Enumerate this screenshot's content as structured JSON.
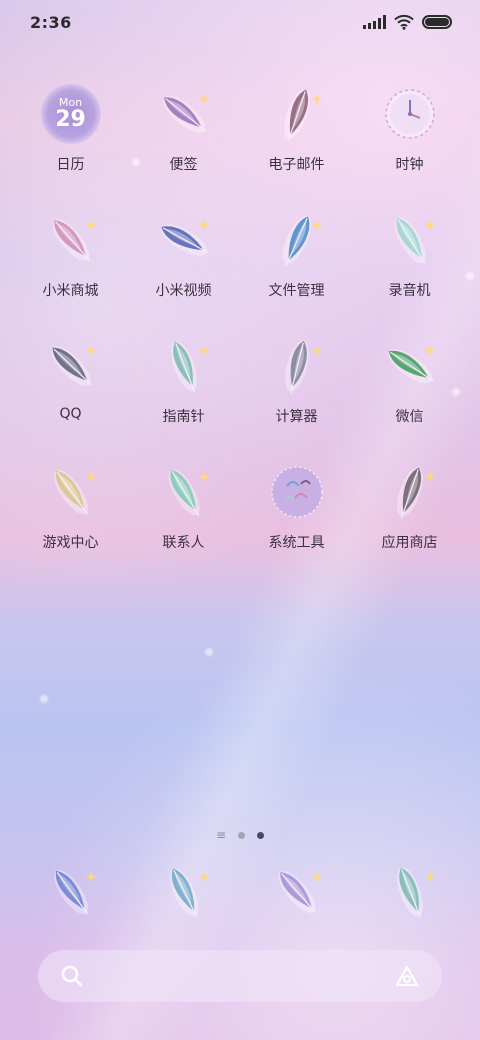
{
  "status_bar": {
    "time": "2:36"
  },
  "apps": [
    {
      "label": "日历",
      "icon": "calendar-icon",
      "month": "Mon",
      "day": "29"
    },
    {
      "label": "便签",
      "icon": "feather-icon"
    },
    {
      "label": "电子邮件",
      "icon": "feather-icon"
    },
    {
      "label": "时钟",
      "icon": "feather-clock-icon"
    },
    {
      "label": "小米商城",
      "icon": "feather-icon"
    },
    {
      "label": "小米视频",
      "icon": "feather-icon"
    },
    {
      "label": "文件管理",
      "icon": "feather-icon"
    },
    {
      "label": "录音机",
      "icon": "feather-icon"
    },
    {
      "label": "QQ",
      "icon": "feather-icon"
    },
    {
      "label": "指南针",
      "icon": "feather-icon"
    },
    {
      "label": "计算器",
      "icon": "feather-icon"
    },
    {
      "label": "微信",
      "icon": "feather-icon"
    },
    {
      "label": "游戏中心",
      "icon": "feather-icon"
    },
    {
      "label": "联系人",
      "icon": "feather-icon"
    },
    {
      "label": "系统工具",
      "icon": "folder-icon"
    },
    {
      "label": "应用商店",
      "icon": "feather-icon"
    }
  ],
  "page_indicator": {
    "current_page": 2,
    "total_pages": 2
  },
  "dock": [
    {
      "icon": "feather-phone-icon"
    },
    {
      "icon": "feather-messages-icon"
    },
    {
      "icon": "feather-browser-icon"
    },
    {
      "icon": "feather-camera-icon"
    }
  ],
  "search_bar": {
    "search_icon": "search-icon",
    "assistant_icon": "assistant-icon"
  },
  "colors": {
    "feather_palette": [
      "#6a7fd0",
      "#9a6fb8",
      "#8a5a72",
      "#6fa7c9",
      "#d08ab5",
      "#4f5fb3",
      "#4a86c8",
      "#9dd5cf",
      "#5c5e7a",
      "#79b7b0",
      "#7e7f96",
      "#3e9a5a",
      "#d9c38a",
      "#7dc9b4",
      "#a58ad7",
      "#6b5a6a"
    ],
    "text_dark": "#3a3140"
  }
}
